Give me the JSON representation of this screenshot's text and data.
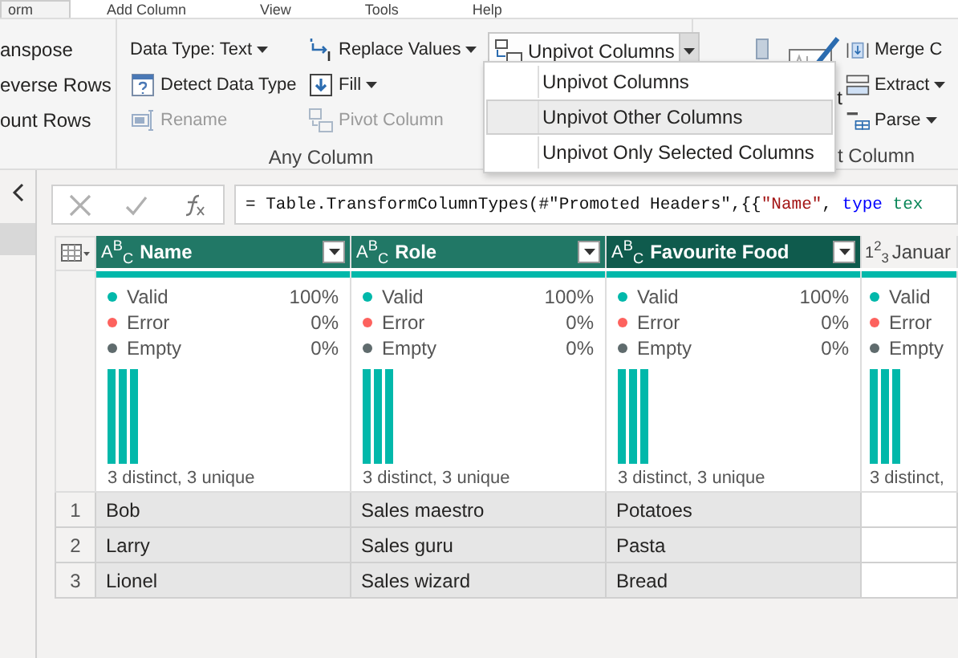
{
  "ribbon": {
    "tabs": [
      {
        "label": "orm",
        "selected": true
      },
      {
        "label": "Add Column",
        "selected": false
      },
      {
        "label": "View",
        "selected": false
      },
      {
        "label": "Tools",
        "selected": false
      },
      {
        "label": "Help",
        "selected": false
      }
    ],
    "table_group": {
      "items": [
        "anspose",
        "everse Rows",
        "ount Rows"
      ]
    },
    "any_column_group": {
      "label": "Any Column",
      "columns": [
        [
          {
            "label": "Data Type: Text",
            "dropdown": true,
            "disabled": false
          },
          {
            "label": "Detect Data Type",
            "dropdown": false,
            "disabled": false
          },
          {
            "label": "Rename",
            "dropdown": false,
            "disabled": true
          }
        ],
        [
          {
            "label": "Replace Values",
            "dropdown": true,
            "disabled": false
          },
          {
            "label": "Fill",
            "dropdown": true,
            "disabled": false
          },
          {
            "label": "Pivot Column",
            "dropdown": false,
            "disabled": true
          }
        ]
      ],
      "unpivot_button": {
        "label": "Unpivot Columns",
        "expanded": true
      }
    },
    "text_column_group": {
      "label": "t Column",
      "large_button": "t",
      "buttons": [
        {
          "label": "Merge C",
          "dropdown": false
        },
        {
          "label": "Extract",
          "dropdown": true
        },
        {
          "label": "Parse",
          "dropdown": true
        }
      ]
    }
  },
  "unpivot_menu": {
    "items": [
      {
        "label": "Unpivot Columns",
        "selected": false
      },
      {
        "label": "Unpivot Other Columns",
        "selected": true
      },
      {
        "label": "Unpivot Only Selected Columns",
        "selected": false
      }
    ]
  },
  "formula_bar": {
    "segments": [
      {
        "text": "= Table.TransformColumnTypes(#\"Promoted Headers\",{{",
        "kind": "plain"
      },
      {
        "text": "\"Name\"",
        "kind": "string"
      },
      {
        "text": ",",
        "kind": "plain"
      },
      {
        "text": "type",
        "kind": "keyword"
      },
      {
        "text": "tex",
        "kind": "type"
      }
    ]
  },
  "table": {
    "columns": [
      {
        "name": "Name",
        "type": "A$^{B}$$_{C}$",
        "kind": "text",
        "selected": false,
        "highlighted": true,
        "filter": true,
        "profile": {
          "stats": [
            {
              "label": "Valid",
              "value": "100%",
              "color": "#01b8aa"
            },
            {
              "label": "Error",
              "value": "0%",
              "color": "#fd625e"
            },
            {
              "label": "Empty",
              "value": "0%",
              "color": "#5f6b6d"
            }
          ],
          "summary": "3 distinct, 3 unique"
        }
      },
      {
        "name": "Role",
        "type": "A$^{B}$$_{C}$",
        "kind": "text",
        "selected": false,
        "highlighted": true,
        "filter": true,
        "profile": {
          "stats": [
            {
              "label": "Valid",
              "value": "100%",
              "color": "#01b8aa"
            },
            {
              "label": "Error",
              "value": "0%",
              "color": "#fd625e"
            },
            {
              "label": "Empty",
              "value": "0%",
              "color": "#5f6b6d"
            }
          ],
          "summary": "3 distinct, 3 unique"
        }
      },
      {
        "name": "Favourite Food",
        "type": "A$^{B}$$_{C}$",
        "kind": "text",
        "selected": true,
        "highlighted": true,
        "filter": true,
        "profile": {
          "stats": [
            {
              "label": "Valid",
              "value": "100%",
              "color": "#01b8aa"
            },
            {
              "label": "Error",
              "value": "0%",
              "color": "#fd625e"
            },
            {
              "label": "Empty",
              "value": "0%",
              "color": "#5f6b6d"
            }
          ],
          "summary": "3 distinct, 3 unique"
        }
      },
      {
        "name": "Januar",
        "type": "1$^{2}$$_{3}$",
        "kind": "number",
        "selected": false,
        "highlighted": false,
        "filter": false,
        "profile": {
          "stats": [
            {
              "label": "Valid",
              "color": "#01b8aa"
            },
            {
              "label": "Error",
              "color": "#fd625e"
            },
            {
              "label": "Empty",
              "color": "#5f6b6d"
            }
          ],
          "summary": "3 distinct,"
        }
      }
    ],
    "rows": [
      {
        "number": "1",
        "cells": [
          "Bob",
          "Sales maestro",
          "Potatoes"
        ]
      },
      {
        "number": "2",
        "cells": [
          "Larry",
          "Sales guru",
          "Pasta"
        ]
      },
      {
        "number": "3",
        "cells": [
          "Lionel",
          "Sales wizard",
          "Bread"
        ]
      }
    ]
  }
}
